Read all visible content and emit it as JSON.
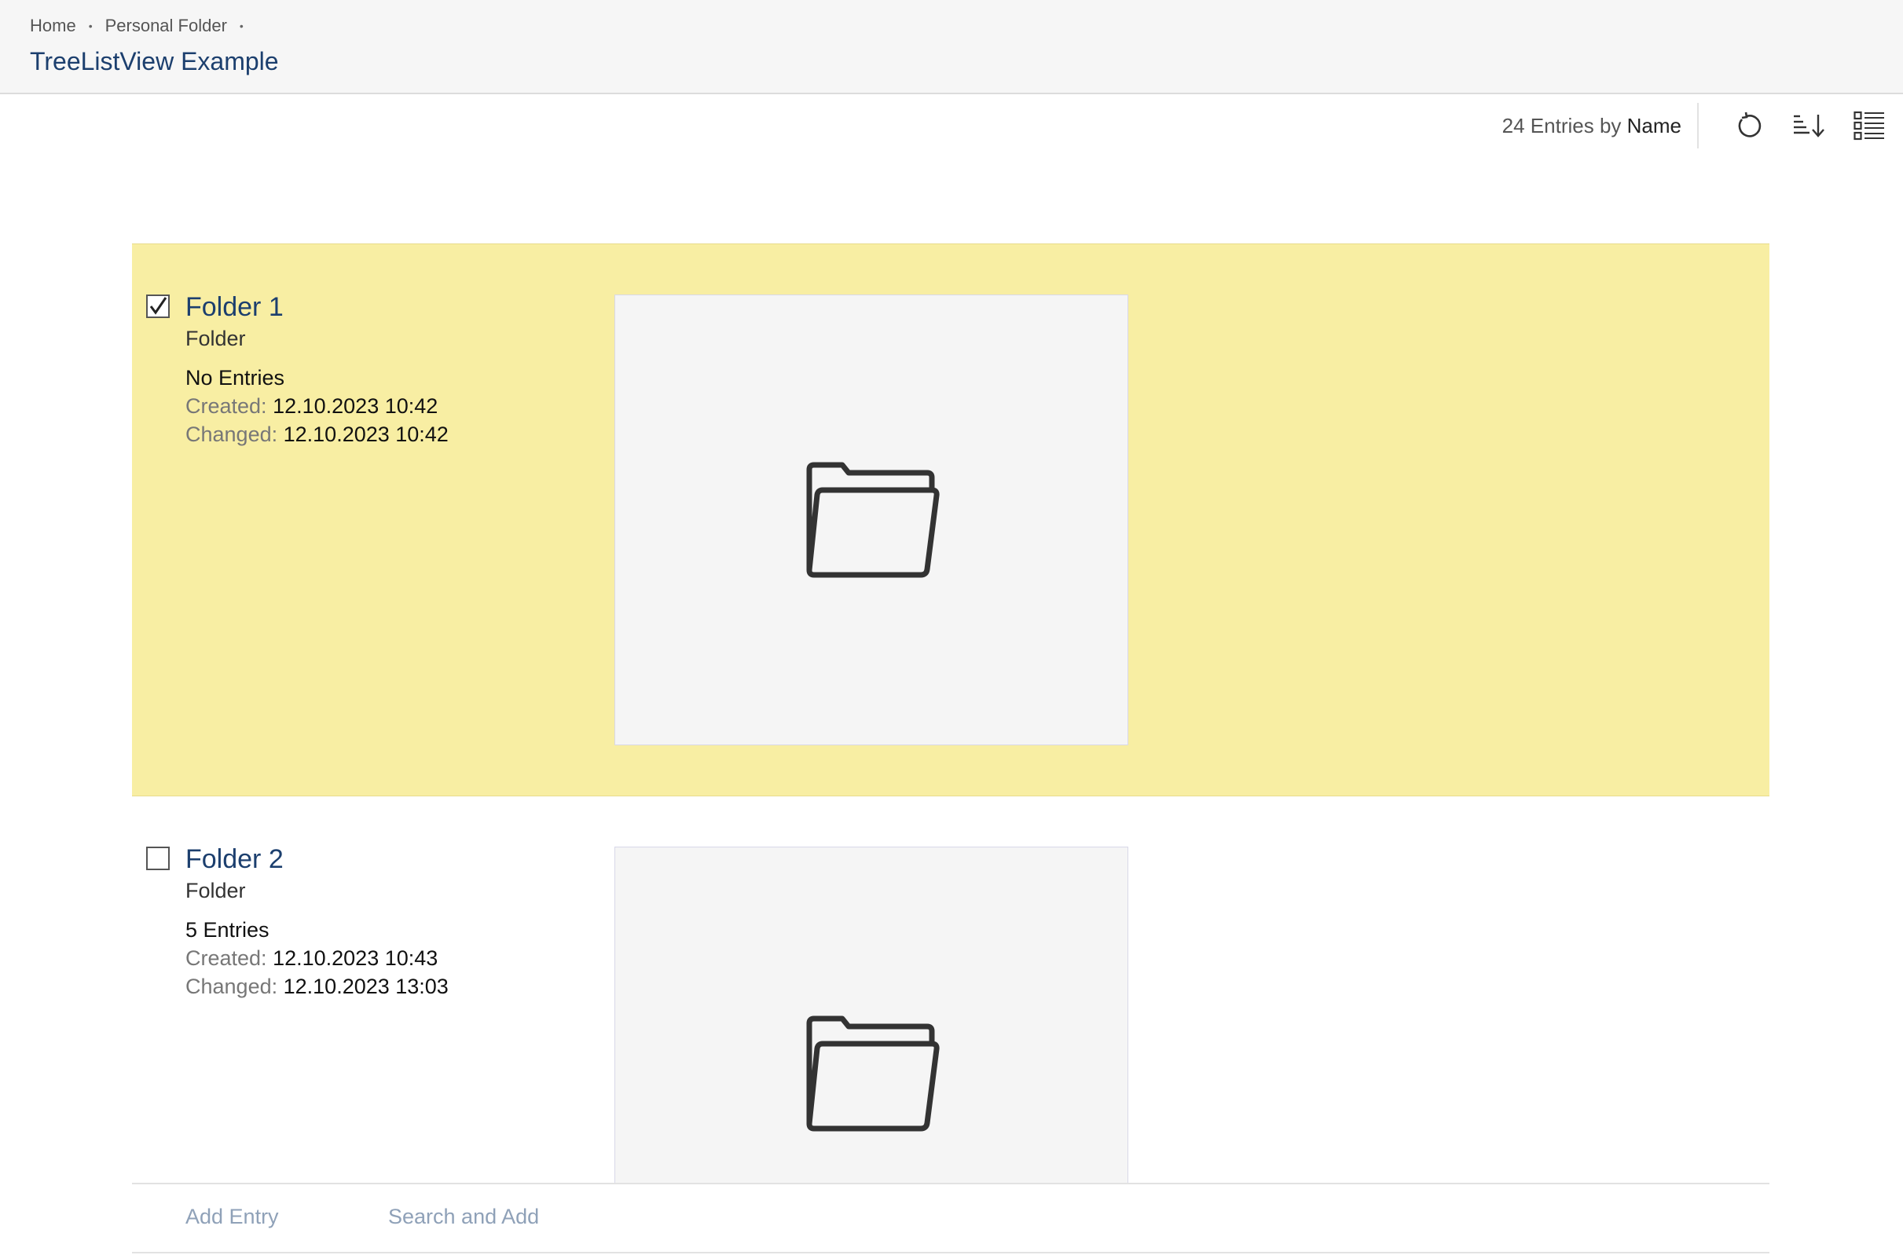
{
  "breadcrumb": {
    "items": [
      "Home",
      "Personal Folder"
    ]
  },
  "page_title": "TreeListView Example",
  "toolbar": {
    "count_text": "24 Entries by",
    "sort_field": "Name",
    "icons": [
      "refresh-icon",
      "sort-descending-icon",
      "list-view-icon"
    ]
  },
  "entries": [
    {
      "name": "Folder 1",
      "type": "Folder",
      "count": "No Entries",
      "created_label": "Created:",
      "created": "12.10.2023 10:42",
      "changed_label": "Changed:",
      "changed": "12.10.2023 10:42",
      "selected": true,
      "icon": "folder-open-icon"
    },
    {
      "name": "Folder 2",
      "type": "Folder",
      "count": "5 Entries",
      "created_label": "Created:",
      "created": "12.10.2023 10:43",
      "changed_label": "Changed:",
      "changed": "12.10.2023 13:03",
      "selected": false,
      "icon": "folder-open-icon"
    }
  ],
  "footer": {
    "add_entry": "Add Entry",
    "search_add": "Search and Add"
  },
  "colors": {
    "selected_row": "#f8eea3",
    "title": "#1c3f6e",
    "footer_link": "#8fa1b8"
  }
}
